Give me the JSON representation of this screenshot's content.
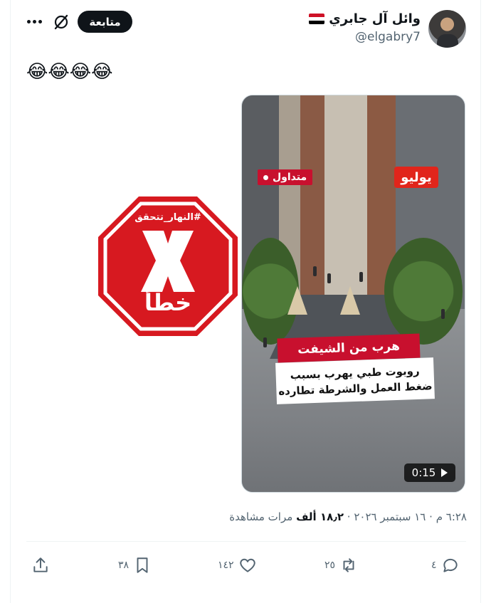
{
  "user": {
    "name": "وائل آل جابري",
    "handle": "@elgabry7",
    "flag": "egypt-flag-icon"
  },
  "header": {
    "follow_label": "متابعة",
    "grok_icon": "grok-icon",
    "more_icon": "more-icon"
  },
  "tweet": {
    "text": "😂😂😂😂"
  },
  "media": {
    "channel_logo": "يوليو",
    "trending_label": "متداول",
    "headline": "هرب من الشيفت",
    "subtitle_line1": "روبوت طبي يهرب بسبب",
    "subtitle_line2": "ضغط العمل والشرطة تطارده",
    "duration": "0:15"
  },
  "stamp": {
    "tag": "#النهار_تتحقق",
    "verdict": "خطأ",
    "color": "#d71920"
  },
  "meta": {
    "time": "٦:٢٨ م",
    "date": "١٦ سبتمبر ٢٠٢٦",
    "views_count": "١٨٫٢ ألف",
    "views_label": "مرات مشاهدة",
    "separator": "·"
  },
  "actions": {
    "replies": "٤",
    "reposts": "٢٥",
    "likes": "١٤٢",
    "bookmarks": "٣٨"
  },
  "colors": {
    "text_primary": "#0f1419",
    "text_secondary": "#536471",
    "border": "#eff3f4"
  }
}
